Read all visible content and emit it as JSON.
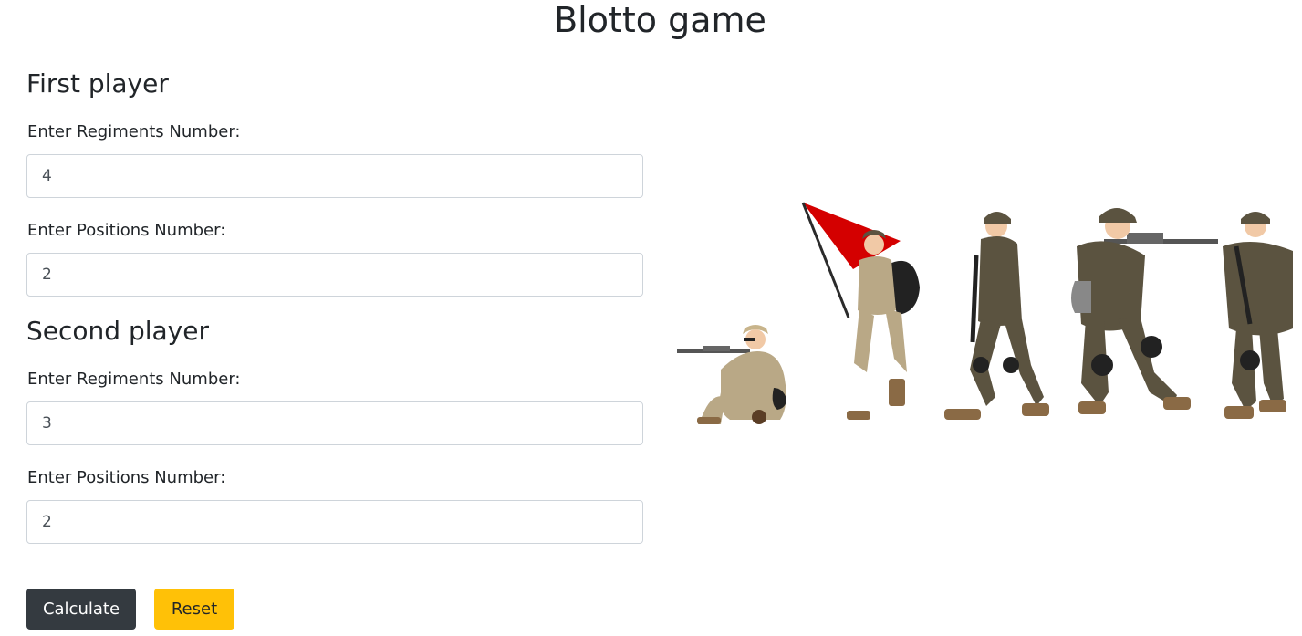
{
  "page": {
    "title": "Blotto game"
  },
  "first_player": {
    "heading": "First player",
    "regiments_label": "Enter Regiments Number:",
    "regiments_value": "4",
    "positions_label": "Enter Positions Number:",
    "positions_value": "2"
  },
  "second_player": {
    "heading": "Second player",
    "regiments_label": "Enter Regiments Number:",
    "regiments_value": "3",
    "positions_label": "Enter Positions Number:",
    "positions_value": "2"
  },
  "actions": {
    "calculate_label": "Calculate",
    "reset_label": "Reset"
  },
  "illustration": {
    "name": "soldiers-illustration",
    "flag_color": "#d40000",
    "uniform_color": "#5b5340",
    "desert_color": "#b9a886",
    "boot_color": "#8a6a45"
  },
  "colors": {
    "calculate_bg": "#343a40",
    "reset_bg": "#ffc107"
  }
}
